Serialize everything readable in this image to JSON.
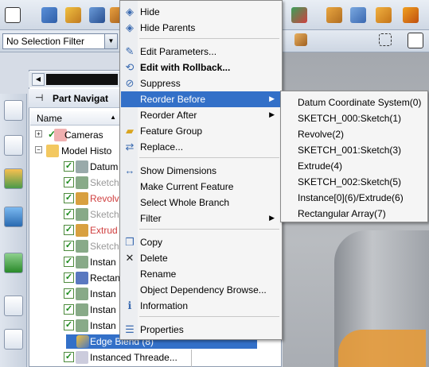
{
  "toolbar": {
    "selection_filter": "No Selection Filter"
  },
  "navigator": {
    "title": "Part Navigat",
    "column_name": "Name",
    "rows": [
      {
        "label": "Cameras",
        "style": "normal"
      },
      {
        "label": "Model Histo",
        "style": "normal"
      },
      {
        "label": "Datum",
        "style": "normal"
      },
      {
        "label": "Sketch",
        "style": "gray"
      },
      {
        "label": "Revolv",
        "style": "red"
      },
      {
        "label": "Sketch",
        "style": "gray"
      },
      {
        "label": "Extrud",
        "style": "red"
      },
      {
        "label": "Sketch",
        "style": "gray"
      },
      {
        "label": "Instan",
        "style": "normal"
      },
      {
        "label": "Rectan",
        "style": "normal"
      },
      {
        "label": "Instan",
        "style": "normal"
      },
      {
        "label": "Instan",
        "style": "normal"
      },
      {
        "label": "Instan",
        "style": "normal"
      }
    ],
    "selected_row": "Edge Blend (8)",
    "last_row": "Instanced Threade..."
  },
  "context_menu": {
    "items": [
      {
        "label": "Hide",
        "icon": "hide-icon"
      },
      {
        "label": "Hide Parents",
        "icon": "hide-parents-icon"
      },
      {
        "label": "Edit Parameters...",
        "icon": "edit-parameters-icon"
      },
      {
        "label": "Edit with Rollback...",
        "icon": "rollback-icon",
        "bold": true
      },
      {
        "label": "Suppress",
        "icon": "suppress-icon"
      },
      {
        "label": "Reorder Before",
        "submenu": true,
        "highlighted": true
      },
      {
        "label": "Reorder After",
        "submenu": true
      },
      {
        "label": "Feature Group",
        "icon": "folder-icon"
      },
      {
        "label": "Replace...",
        "icon": "replace-icon"
      },
      {
        "label": "Show Dimensions",
        "icon": "dimensions-icon"
      },
      {
        "label": "Make Current Feature"
      },
      {
        "label": "Select Whole Branch"
      },
      {
        "label": "Filter",
        "submenu": true
      },
      {
        "label": "Copy",
        "icon": "copy-icon"
      },
      {
        "label": "Delete",
        "icon": "delete-icon"
      },
      {
        "label": "Rename"
      },
      {
        "label": "Object Dependency Browse..."
      },
      {
        "label": "Information",
        "icon": "information-icon"
      },
      {
        "label": "Properties",
        "icon": "properties-icon"
      }
    ]
  },
  "reorder_submenu": {
    "items": [
      "Datum Coordinate System(0)",
      "SKETCH_000:Sketch(1)",
      "Revolve(2)",
      "SKETCH_001:Sketch(3)",
      "Extrude(4)",
      "SKETCH_002:Sketch(5)",
      "Instance[0](6)/Extrude(6)",
      "Rectangular Array(7)"
    ]
  },
  "colors": {
    "highlight": "#3370c8",
    "suppressed_red": "#d04040",
    "check_green": "#1a8a1a",
    "blend_orange": "#e49a3a"
  }
}
